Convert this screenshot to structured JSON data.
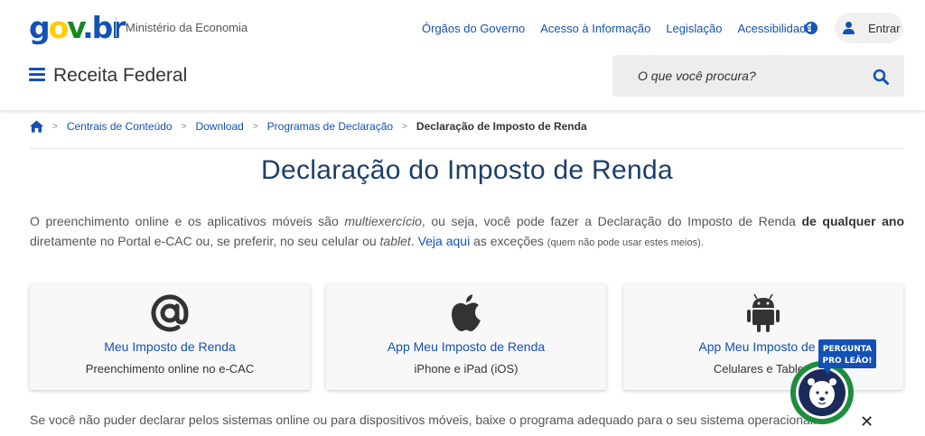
{
  "header": {
    "logo": {
      "g": "g",
      "o": "o",
      "v": "v",
      "dot": ".",
      "br": "br"
    },
    "ministry": "Ministério da Economia",
    "nav": [
      "Órgãos do Governo",
      "Acesso à Informação",
      "Legislação",
      "Acessibilidade"
    ],
    "login_label": "Entrar",
    "site_title": "Receita Federal",
    "search_placeholder": "O que você procura?"
  },
  "breadcrumb": {
    "items": [
      "Centrais de Conteúdo",
      "Download",
      "Programas de Declaração"
    ],
    "current": "Declaração de Imposto de Renda",
    "separator": ">"
  },
  "main": {
    "title": "Declaração do Imposto de Renda",
    "intro": {
      "p1": "O preenchimento online e os aplicativos móveis são ",
      "p1_em": "multiexercício",
      "p2": ", ou seja, você pode fazer a Declaração do Imposto de Renda ",
      "p2_strong": "de qualquer ano",
      "p3": " diretamente no Portal e-CAC ou, se preferir, no seu celular ou ",
      "p3_em": "tablet",
      "p4": ". ",
      "link": "Veja aqui",
      "p5": " as exceções ",
      "small": "(quem não pode usar estes meios)."
    },
    "cards": [
      {
        "icon": "at-sign-icon",
        "title": "Meu Imposto de Renda",
        "subtitle": "Preenchimento online no e-CAC"
      },
      {
        "icon": "apple-icon",
        "title": "App Meu Imposto de Renda",
        "subtitle": "iPhone e iPad (iOS)"
      },
      {
        "icon": "android-icon",
        "title": "App Meu Imposto de R",
        "subtitle": "Celulares e Tablets"
      }
    ],
    "footer": "Se você não puder declarar pelos sistemas online ou para dispositivos móveis, baixe o programa adequado para o seu sistema operacional."
  },
  "widget": {
    "line1": "PERGUNTA",
    "line2": "PRO LEÃO!",
    "close": "✕"
  },
  "colors": {
    "primary_blue": "#1351b4",
    "title_navy": "#1c3e6b",
    "gov_yellow": "#ffcd07",
    "gov_green": "#168821",
    "widget_green": "#1e8e3e",
    "widget_navy": "#1b2a5a"
  }
}
